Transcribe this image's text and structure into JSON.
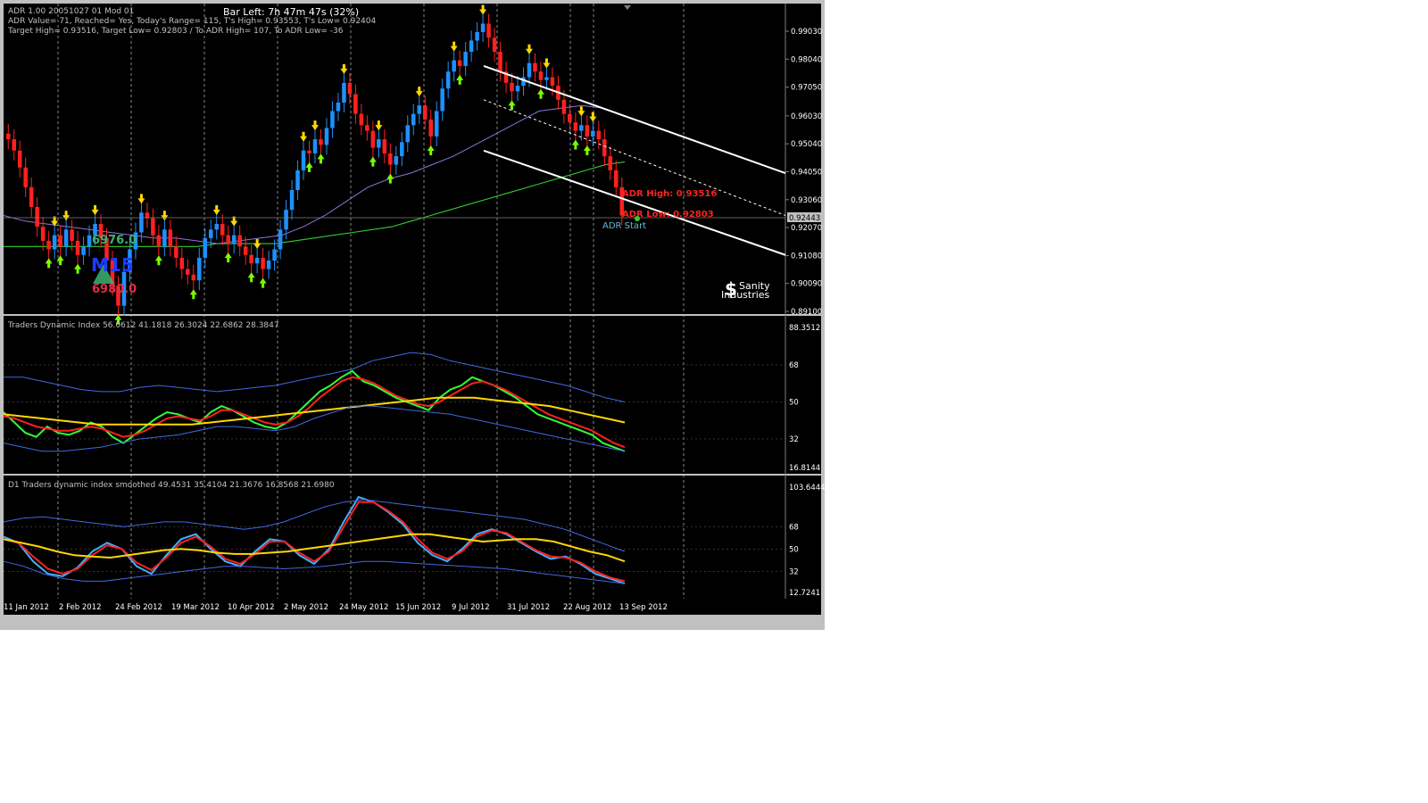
{
  "header": {
    "indicator_line1": "ADR 1.00 20051027 01 Mod 01",
    "indicator_line2": "ADR Value= 71, Reached= Yes, Today's Range= 115, T's High= 0.93553, T's Low= 0.92404",
    "indicator_line3": "Target High= 0.93516, Target Low= 0.92803 / To ADR High= 107, To ADR Low= -36",
    "bar_left": "Bar Left: 7h 47m 47s (32%)"
  },
  "watermark": {
    "line1": "Sanity",
    "line2": "Industries",
    "symbol": "$"
  },
  "overlay": {
    "upper_value": "6976.0",
    "timeframe": "M15",
    "lower_value": "6980.0"
  },
  "adr_labels": {
    "high": "ADR High: 0.93516",
    "low": "ADR Low: 0.92803",
    "start": "ADR Start"
  },
  "current_price": "0.92443",
  "colors": {
    "background": "#000000",
    "frame": "#c0c0c0",
    "bull_candle": "#1e90ff",
    "bear_candle": "#ff2020",
    "ma_long": "#32cd32",
    "ma_short": "#9370db",
    "tdi_rsi": "#32ff32",
    "tdi_signal": "#ff2020",
    "tdi_market_base": "#ffd700",
    "tdi_bands": "#4169e1",
    "smoothed_rsi": "#40b0ff",
    "adr_high_text": "#ff2020",
    "channel": "#ffffff"
  },
  "chart_data": [
    {
      "type": "line",
      "name": "price",
      "y_ticks": [
        "0.99030",
        "0.98040",
        "0.97050",
        "0.96030",
        "0.95040",
        "0.94050",
        "0.93060",
        "0.92070",
        "0.91080",
        "0.90090",
        "0.89100"
      ],
      "ylim": [
        0.891,
        0.996
      ],
      "x_ticks": [
        "11 Jan 2012",
        "2 Feb 2012",
        "24 Feb 2012",
        "19 Mar 2012",
        "10 Apr 2012",
        "2 May 2012",
        "24 May 2012",
        "15 Jun 2012",
        "9 Jul 2012",
        "31 Jul 2012",
        "22 Aug 2012",
        "13 Sep 2012"
      ],
      "close": [
        0.952,
        0.948,
        0.942,
        0.935,
        0.928,
        0.921,
        0.916,
        0.913,
        0.918,
        0.914,
        0.92,
        0.916,
        0.911,
        0.914,
        0.918,
        0.922,
        0.917,
        0.909,
        0.9,
        0.893,
        0.905,
        0.913,
        0.919,
        0.926,
        0.924,
        0.918,
        0.914,
        0.92,
        0.914,
        0.91,
        0.906,
        0.904,
        0.902,
        0.91,
        0.917,
        0.92,
        0.922,
        0.918,
        0.915,
        0.918,
        0.914,
        0.911,
        0.908,
        0.91,
        0.906,
        0.909,
        0.913,
        0.92,
        0.927,
        0.934,
        0.941,
        0.948,
        0.947,
        0.952,
        0.95,
        0.956,
        0.962,
        0.965,
        0.972,
        0.968,
        0.961,
        0.957,
        0.955,
        0.949,
        0.952,
        0.947,
        0.943,
        0.946,
        0.951,
        0.957,
        0.961,
        0.964,
        0.959,
        0.953,
        0.962,
        0.97,
        0.976,
        0.98,
        0.978,
        0.983,
        0.987,
        0.99,
        0.993,
        0.988,
        0.983,
        0.976,
        0.972,
        0.969,
        0.971,
        0.974,
        0.979,
        0.976,
        0.973,
        0.974,
        0.971,
        0.966,
        0.961,
        0.958,
        0.955,
        0.957,
        0.953,
        0.955,
        0.952,
        0.946,
        0.941,
        0.935,
        0.925
      ],
      "ma_long": [
        0.914,
        0.914,
        0.914,
        0.914,
        0.914,
        0.914,
        0.914,
        0.914,
        0.914,
        0.914,
        0.914,
        0.915,
        0.915,
        0.915,
        0.915,
        0.916,
        0.917,
        0.918,
        0.919,
        0.92,
        0.921,
        0.923,
        0.925,
        0.927,
        0.929,
        0.931,
        0.933,
        0.935,
        0.937,
        0.939,
        0.941,
        0.943,
        0.944
      ],
      "ma_short": [
        0.925,
        0.923,
        0.922,
        0.921,
        0.92,
        0.919,
        0.918,
        0.917,
        0.917,
        0.916,
        0.915,
        0.916,
        0.917,
        0.918,
        0.921,
        0.925,
        0.93,
        0.935,
        0.938,
        0.94,
        0.943,
        0.946,
        0.95,
        0.954,
        0.958,
        0.962,
        0.963,
        0.964,
        0.963,
        0.96
      ],
      "channel_upper": [
        [
          0.978,
          0.94
        ]
      ],
      "channel_mid": [
        [
          0.966,
          0.925
        ]
      ],
      "channel_lower": [
        [
          0.948,
          0.911
        ]
      ]
    },
    {
      "type": "line",
      "title": "Traders Dynamic Index 56.0612 41.1818 26.3024 22.6862 28.3847",
      "y_ticks": [
        "88.3512",
        "68",
        "50",
        "32",
        "16.8144"
      ],
      "ylim": [
        16.8144,
        88.3512
      ],
      "series": [
        {
          "name": "rsi",
          "values": [
            45,
            40,
            35,
            33,
            38,
            35,
            34,
            36,
            40,
            38,
            33,
            30,
            34,
            38,
            42,
            45,
            44,
            42,
            40,
            45,
            48,
            46,
            43,
            40,
            38,
            37,
            40,
            45,
            50,
            55,
            58,
            62,
            65,
            60,
            58,
            55,
            52,
            50,
            48,
            46,
            52,
            56,
            58,
            62,
            60,
            58,
            55,
            52,
            48,
            44,
            42,
            40,
            38,
            36,
            34,
            30,
            28,
            26
          ]
        },
        {
          "name": "signal",
          "values": [
            43,
            42,
            40,
            38,
            37,
            36,
            36,
            37,
            38,
            37,
            35,
            33,
            34,
            36,
            39,
            42,
            43,
            42,
            41,
            43,
            46,
            46,
            44,
            42,
            40,
            39,
            40,
            43,
            47,
            52,
            56,
            60,
            62,
            61,
            59,
            56,
            53,
            51,
            49,
            48,
            50,
            53,
            56,
            59,
            60,
            58,
            56,
            53,
            50,
            47,
            44,
            42,
            40,
            38,
            36,
            33,
            30,
            28
          ]
        },
        {
          "name": "market_base",
          "values": [
            44,
            43,
            42,
            41,
            40,
            39,
            39,
            39,
            39,
            39,
            39,
            40,
            41,
            42,
            43,
            44,
            45,
            46,
            47,
            48,
            49,
            50,
            51,
            52,
            52,
            52,
            51,
            50,
            49,
            48,
            46,
            44,
            42,
            40
          ]
        },
        {
          "name": "upper_band",
          "values": [
            62,
            62,
            60,
            58,
            56,
            55,
            55,
            57,
            58,
            57,
            56,
            55,
            56,
            57,
            58,
            60,
            62,
            64,
            66,
            70,
            72,
            74,
            73,
            70,
            68,
            66,
            64,
            62,
            60,
            58,
            55,
            52,
            50
          ]
        },
        {
          "name": "lower_band",
          "values": [
            30,
            28,
            26,
            26,
            27,
            28,
            30,
            32,
            33,
            34,
            36,
            38,
            38,
            37,
            36,
            38,
            42,
            45,
            48,
            48,
            47,
            46,
            45,
            44,
            42,
            40,
            38,
            36,
            34,
            32,
            30,
            28,
            26
          ]
        }
      ]
    },
    {
      "type": "line",
      "title": "D1 Traders dynamic index smoothed 49.4531 35.4104 21.3676 16.8568 21.6980",
      "y_ticks": [
        "103.6444",
        "68",
        "50",
        "32",
        "12.7241"
      ],
      "ylim": [
        12.7241,
        103.6444
      ],
      "series": [
        {
          "name": "rsi_smoothed",
          "values": [
            60,
            55,
            40,
            30,
            28,
            35,
            48,
            55,
            50,
            36,
            30,
            45,
            58,
            62,
            50,
            40,
            36,
            48,
            58,
            56,
            45,
            38,
            50,
            72,
            92,
            88,
            80,
            70,
            55,
            45,
            40,
            50,
            62,
            66,
            62,
            55,
            48,
            42,
            44,
            38,
            30,
            26,
            22
          ]
        },
        {
          "name": "signal",
          "values": [
            58,
            55,
            44,
            34,
            30,
            34,
            45,
            53,
            50,
            39,
            33,
            43,
            55,
            60,
            52,
            42,
            38,
            46,
            56,
            56,
            47,
            40,
            48,
            68,
            88,
            88,
            81,
            72,
            58,
            47,
            42,
            48,
            60,
            65,
            63,
            56,
            49,
            44,
            43,
            39,
            32,
            27,
            24
          ]
        },
        {
          "name": "market_base",
          "values": [
            58,
            55,
            52,
            48,
            45,
            44,
            43,
            45,
            47,
            49,
            50,
            49,
            47,
            46,
            46,
            47,
            48,
            50,
            52,
            54,
            56,
            58,
            60,
            62,
            62,
            60,
            58,
            56,
            57,
            58,
            58,
            56,
            52,
            48,
            45,
            40
          ]
        },
        {
          "name": "upper_band",
          "values": [
            72,
            75,
            76,
            74,
            72,
            70,
            68,
            70,
            72,
            72,
            70,
            68,
            66,
            68,
            72,
            78,
            84,
            88,
            90,
            88,
            86,
            84,
            82,
            80,
            78,
            76,
            74,
            70,
            66,
            60,
            54,
            48
          ]
        },
        {
          "name": "lower_band",
          "values": [
            40,
            36,
            30,
            26,
            24,
            24,
            26,
            28,
            30,
            32,
            34,
            36,
            36,
            35,
            34,
            35,
            36,
            38,
            40,
            40,
            39,
            38,
            37,
            36,
            35,
            34,
            32,
            30,
            28,
            26,
            24,
            22
          ]
        }
      ]
    }
  ]
}
